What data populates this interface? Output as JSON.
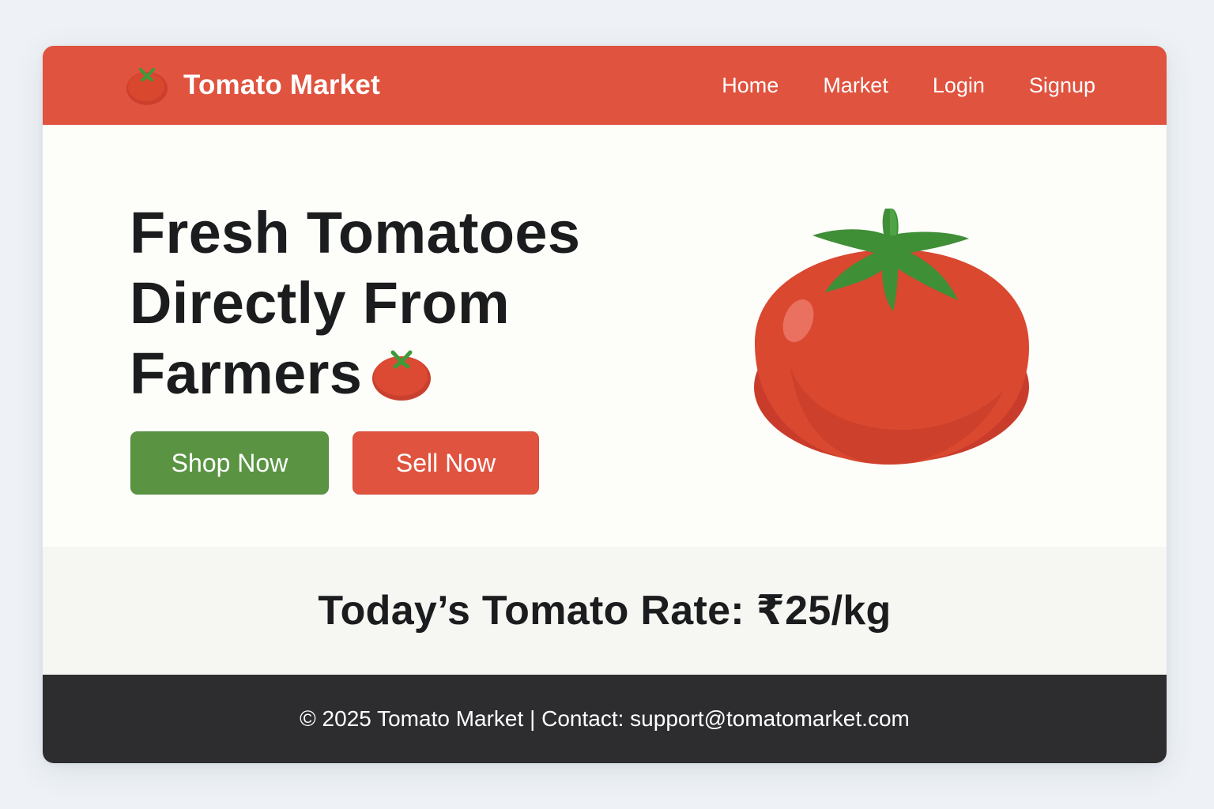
{
  "brand": {
    "name": "Tomato Market",
    "logo_icon": "tomato-icon"
  },
  "nav": {
    "items": [
      {
        "label": "Home"
      },
      {
        "label": "Market"
      },
      {
        "label": "Login"
      },
      {
        "label": "Signup"
      }
    ]
  },
  "hero": {
    "title_lines": [
      "Fresh Tomatoes",
      "Directly From",
      "Farmers"
    ],
    "title_icon": "tomato-icon",
    "shop_button": "Shop Now",
    "sell_button": "Sell Now",
    "illustration": "tomato-illustration"
  },
  "rate": {
    "text": "Today’s Tomato Rate: ₹25/kg"
  },
  "footer": {
    "text": "© 2025 Tomato Market | Contact: support@tomatomarket.com"
  },
  "colors": {
    "primary_red": "#e0533f",
    "primary_green": "#5a9443",
    "footer_bg": "#2d2d2f",
    "page_bg": "#eef2f6",
    "text_dark": "#1b1c1e"
  }
}
